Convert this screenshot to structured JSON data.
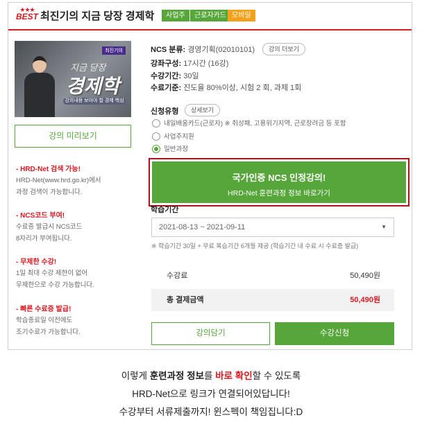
{
  "header": {
    "stars": "★★★",
    "best": "BEST",
    "title": "최진기의 지금 당장 경제학",
    "badges": [
      {
        "label": "사업주",
        "color": "#56a63a"
      },
      {
        "label": "근로자카드",
        "color": "#56a63a"
      },
      {
        "label": "모바일",
        "color": "#f2a21a"
      }
    ]
  },
  "thumbnail": {
    "line1": "지금 당장",
    "line2": "경제학",
    "sub": "강의내용 보아야 할 경제 핵심",
    "corner": "최진기의"
  },
  "preview_button": "강의 미리보기",
  "side_notes": [
    {
      "title": "- HRD-Net 검색 가능!",
      "lines": [
        "HRD-Net(www.hrd.go.kr)에서",
        "과정 검색이 가능합니다."
      ]
    },
    {
      "title": "- NCS코드 부여!",
      "lines": [
        "수료증 발급시 NCS코드",
        "8자리가 부여됩니다."
      ]
    },
    {
      "title": "- 무제한 수강!",
      "lines": [
        "1일 최대 수강 제한이 없어",
        "무제한으로 수강 가능합니다."
      ]
    },
    {
      "title": "- 빠른 수료증 발급!",
      "lines": [
        "학습종료일 이전에도",
        "조기수료가 가능합니다."
      ]
    }
  ],
  "info": {
    "ncs_label": "NCS 분류:",
    "ncs_value": "경영기획(02010101)",
    "more_button": "강의 더보기",
    "composition_label": "강좌구성:",
    "composition_value": "17시간 (16강)",
    "period_label": "수강기간:",
    "period_value": "30일",
    "criteria_label": "수료기준:",
    "criteria_value": "진도율 80%이상, 시험 2 회, 과제 1회"
  },
  "application": {
    "label": "신청유형",
    "detail_button": "상세보기",
    "options": [
      {
        "text": "내일배움카드(근로자) ※ 취성패, 고용위기지역, 근로장려금 등 포함",
        "selected": false
      },
      {
        "text": "사업주지원",
        "selected": false
      },
      {
        "text": "일반과정",
        "selected": true
      }
    ]
  },
  "ncs_banner": {
    "line1": "국가인증 NCS 인정강의!",
    "line2": "HRD-Net 훈련과정 정보 바로가기"
  },
  "study_period": {
    "label": "학습기간",
    "selected": "2021-08-13 ~ 2021-09-11",
    "note": "※ 학습기간 30일 + 무료 복습기간 6개월 제공 (학습기간 내 수료 시 수료증 발급)"
  },
  "price": {
    "fee_label": "수강료",
    "fee_value": "50,490원",
    "total_label": "총 결제금액",
    "total_value": "50,490원"
  },
  "buttons": {
    "cart": "강의담기",
    "enroll": "수강신청"
  },
  "caption": {
    "line1_a": "이렇게 ",
    "line1_b": "훈련과정 정보",
    "line1_c": "를 ",
    "line1_d": "바로 확인",
    "line1_e": "할 수 있도록",
    "line2": "HRD-Net으로 링크가 연결되어있답니다!",
    "line3": "수강부터 서류제출까지! 윈스펙이 책임집니다:D"
  },
  "colors": {
    "accent_green": "#56a63a",
    "accent_red": "#d71920",
    "badge_orange": "#f2a21a"
  }
}
